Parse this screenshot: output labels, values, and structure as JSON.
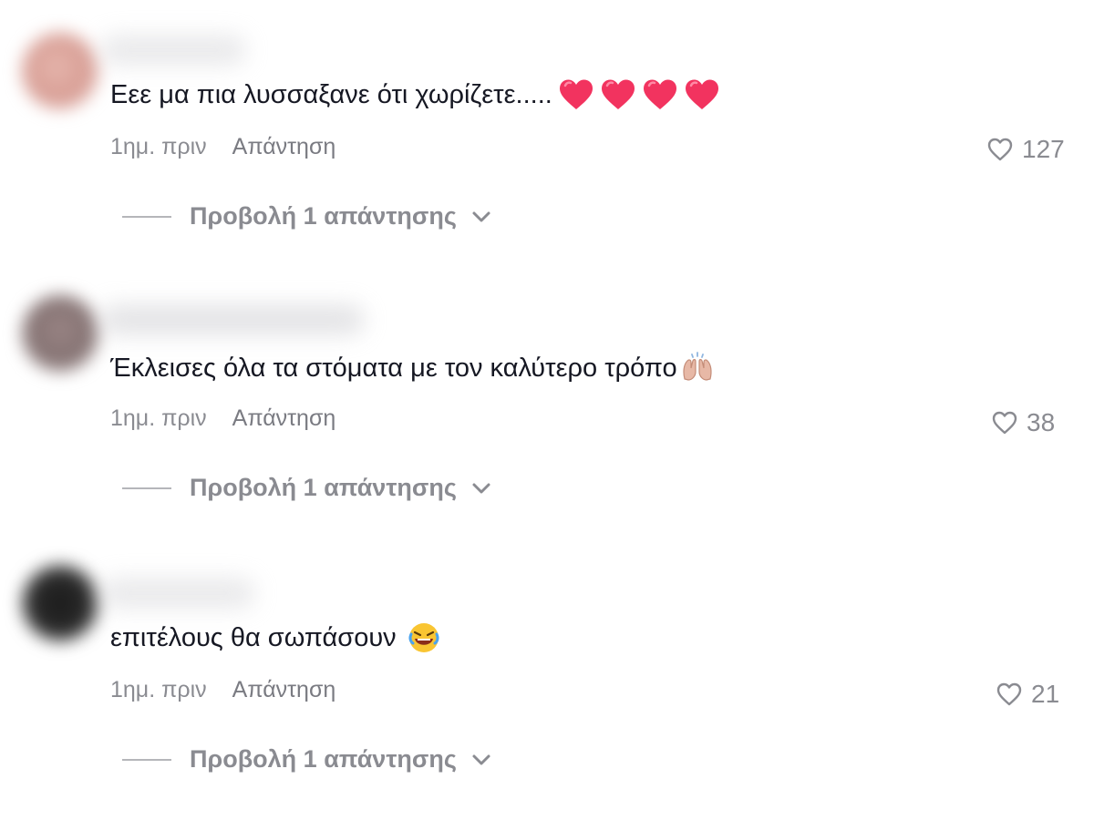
{
  "comments": [
    {
      "text": "Εεε μα πια λυσσαξανε ότι χωρίζετε.....",
      "emoji": "heart-emoji ×4",
      "time": "1ημ. πριν",
      "reply_label": "Απάντηση",
      "likes": "127",
      "view_replies": "Προβολή 1 απάντησης"
    },
    {
      "text": "Έκλεισες όλα τα στόματα με τον καλύτερο τρόπο",
      "emoji": "raising-hands-emoji",
      "time": "1ημ. πριν",
      "reply_label": "Απάντηση",
      "likes": "38",
      "view_replies": "Προβολή 1 απάντησης"
    },
    {
      "text": "επιτέλους θα σωπάσουν",
      "emoji": "rolling-on-floor-laughing-emoji",
      "time": "1ημ. πριν",
      "reply_label": "Απάντηση",
      "likes": "21",
      "view_replies": "Προβολή 1 απάντησης"
    }
  ],
  "colors": {
    "text": "#161823",
    "secondary": "#8a8b91",
    "heart": "#fe2c55"
  },
  "icons": {
    "like": "heart-outline-icon",
    "expand": "chevron-down-icon"
  }
}
